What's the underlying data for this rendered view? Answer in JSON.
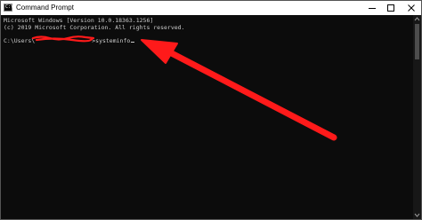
{
  "window": {
    "title": "Command Prompt",
    "icon": "console-icon",
    "controls": {
      "minimize_icon": "minimize-icon",
      "maximize_icon": "maximize-icon",
      "close_icon": "close-icon"
    }
  },
  "console": {
    "lines": [
      "Microsoft Windows [Version 10.0.18363.1256]",
      "(c) 2019 Microsoft Corporation. All rights reserved."
    ],
    "prompt_prefix": "C:\\Users\\",
    "prompt_suffix": ">",
    "command": "systeminfo",
    "text_color": "#cccccc",
    "background_color": "#0c0c0c"
  },
  "annotations": {
    "arrow_color": "#ff1a1a",
    "redaction_color": "#ff1a1a"
  }
}
